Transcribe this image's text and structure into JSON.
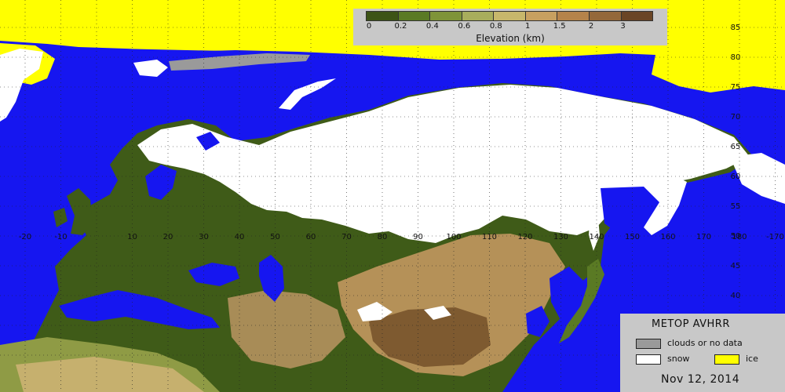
{
  "colors": {
    "ocean": "#1616f0",
    "snow": "#ffffff",
    "ice": "#ffff00",
    "clouds": "#9a9a9a",
    "lowland": "#3f5b18"
  },
  "elevation_legend": {
    "title": "Elevation (km)",
    "colors": [
      "#3d5416",
      "#5a7a24",
      "#7f9438",
      "#a8ad5c",
      "#c7b76b",
      "#c7a060",
      "#b5834a",
      "#94683a",
      "#6a4526"
    ],
    "ticks": [
      "0",
      "0.2",
      "0.4",
      "0.6",
      "0.8",
      "1",
      "1.5",
      "2",
      "3"
    ]
  },
  "legend": {
    "title": "METOP AVHRR",
    "items": [
      {
        "label": "clouds or no data",
        "color": "#9a9a9a"
      },
      {
        "label": "snow",
        "color": "#ffffff"
      },
      {
        "label": "ice",
        "color": "#ffff00"
      }
    ],
    "date": "Nov 12, 2014"
  },
  "lon_labels": [
    "-20",
    "-10",
    "10",
    "20",
    "30",
    "40",
    "50",
    "60",
    "70",
    "80",
    "90",
    "100",
    "110",
    "120",
    "130",
    "140",
    "150",
    "160",
    "170",
    "180",
    "-170"
  ],
  "lat_labels": [
    "85",
    "80",
    "75",
    "70",
    "65",
    "60",
    "55",
    "50",
    "45",
    "40"
  ]
}
